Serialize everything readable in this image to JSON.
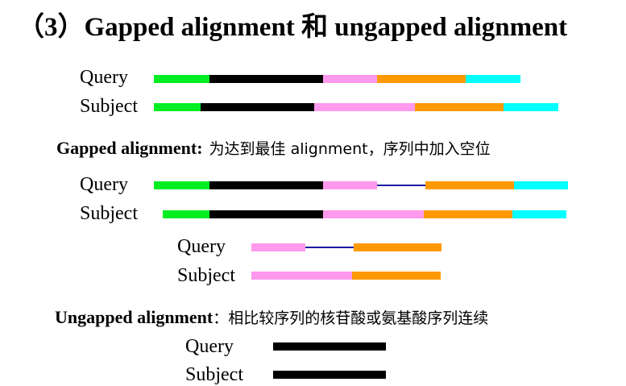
{
  "title": "（3）Gapped alignment 和 ungapped alignment",
  "labels": {
    "query": "Query",
    "subject": "Subject"
  },
  "gapped_heading": {
    "term": "Gapped alignment:",
    "desc": "为达到最佳 alignment，序列中加入空位"
  },
  "ungapped_heading": {
    "term": "Ungapped alignment",
    "desc": "：相比较序列的核苷酸或氨基酸序列连续"
  },
  "colors": {
    "green": "#00ee22",
    "black": "#000000",
    "pink": "#ff99ee",
    "orange": "#ff9900",
    "cyan": "#00ffff",
    "gap": "#1a1aa0"
  }
}
